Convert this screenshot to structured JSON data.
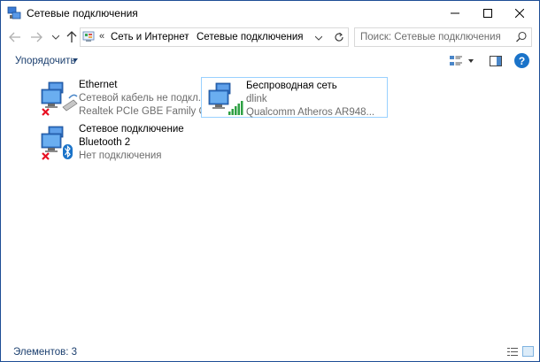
{
  "window": {
    "title": "Сетевые подключения"
  },
  "address": {
    "overflow_marker": "«",
    "crumbs": [
      "Сеть и Интернет",
      "Сетевые подключения"
    ],
    "separator": "›"
  },
  "search": {
    "placeholder": "Поиск: Сетевые подключения"
  },
  "toolbar": {
    "organize_label": "Упорядочить",
    "help_label": "?"
  },
  "connections": [
    {
      "name": "Ethernet",
      "status": "Сетевой кабель не подкл...",
      "device": "Realtek PCIe GBE Family C...",
      "icon": "ethernet-disconnected-icon",
      "selected": false
    },
    {
      "name": "Беспроводная сеть",
      "status": "dlink",
      "device": "Qualcomm Atheros AR948...",
      "icon": "wireless-connected-icon",
      "selected": true
    },
    {
      "name": "Сетевое подключение",
      "status": "Bluetooth 2",
      "device": "Нет подключения",
      "icon": "bluetooth-disconnected-icon",
      "selected": false
    }
  ],
  "statusbar": {
    "items_count": "Элементов: 3"
  },
  "colors": {
    "accent_link": "#1a3e6e",
    "selection_border": "#99d1ff",
    "error_red": "#e81123",
    "signal_green": "#2ea043",
    "help_blue": "#1a73c9"
  }
}
